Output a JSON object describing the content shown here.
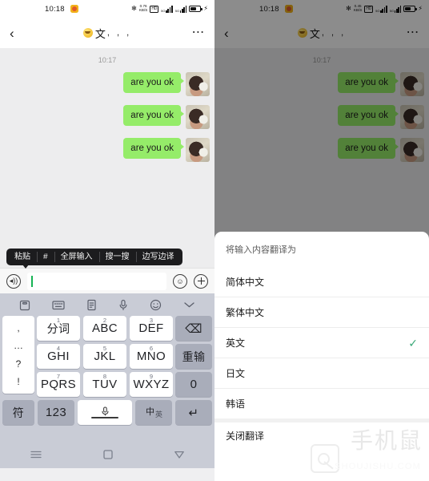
{
  "status_bar": {
    "time": "10:18",
    "app_icon_name": "notification-app-icon",
    "bluetooth_icon": "bluetooth-icon",
    "network_speed_left": "0.76",
    "network_speed_unit_left": "KB/S",
    "network_speed_right": "0.45",
    "network_speed_unit_right": "KB/S",
    "hd_label": "HD",
    "signal_1_label": "5G",
    "signal_2_label": "5G",
    "battery_icon": "battery-icon",
    "charging_icon": "charging-bolt-icon"
  },
  "title_bar": {
    "back_icon": "back-chevron-icon",
    "emoji_icon": "grimacing-face-emoji",
    "contact_name": "文",
    "name_suffix": ", , ,",
    "more_icon": "more-options-icon"
  },
  "chat": {
    "timestamp": "10:17",
    "messages": [
      {
        "text": "are you ok",
        "side": "outgoing"
      },
      {
        "text": "are you ok",
        "side": "outgoing"
      },
      {
        "text": "are you ok",
        "side": "outgoing"
      }
    ],
    "bubble_color": "#95ec69"
  },
  "ime_toolbar": {
    "chips": [
      {
        "label": "粘贴"
      },
      {
        "label": "#"
      },
      {
        "label": "全屏输入"
      },
      {
        "label": "搜一搜"
      },
      {
        "label": "边写边译"
      }
    ]
  },
  "input_bar": {
    "voice_icon": "voice-input-icon",
    "input_value": "",
    "input_placeholder": "",
    "emoji_icon": "emoji-smile-icon",
    "plus_icon": "plus-more-icon",
    "cursor_color": "#16b354"
  },
  "keyboard": {
    "toolbar_icons": [
      "clipboard-icon",
      "keyboard-layout-icon",
      "notes-icon",
      "microphone-icon",
      "emoji-icon",
      "chevron-down-icon"
    ],
    "punct_key": {
      "name": "punctuation-key",
      "glyphs": [
        ",",
        "…",
        "?",
        "!"
      ]
    },
    "keys": [
      {
        "num": "1",
        "label": "分词",
        "cn": true
      },
      {
        "num": "2",
        "label": "ABC",
        "cn": false
      },
      {
        "num": "3",
        "label": "DEF",
        "cn": false
      },
      {
        "num": "4",
        "label": "GHI",
        "cn": false
      },
      {
        "num": "5",
        "label": "JKL",
        "cn": false
      },
      {
        "num": "6",
        "label": "MNO",
        "cn": false
      },
      {
        "num": "7",
        "label": "PQRS",
        "cn": false
      },
      {
        "num": "8",
        "label": "TUV",
        "cn": false
      },
      {
        "num": "9",
        "label": "WXYZ",
        "cn": false
      }
    ],
    "right_keys": [
      {
        "name": "backspace-key",
        "label": "⌫",
        "icon": true
      },
      {
        "name": "redo-key",
        "label": "重输",
        "icon": false
      },
      {
        "name": "zero-key",
        "label": "0",
        "icon": false
      }
    ],
    "bottom_row": {
      "symbol_key": "符",
      "numeric_key": "123",
      "space_key_icon": "microphone-space-icon",
      "lang_key_main": "中",
      "lang_key_sub": "英",
      "enter_key": "↵"
    }
  },
  "nav_bar": {
    "recents_icon": "recents-menu-icon",
    "home_icon": "home-square-icon",
    "back_icon": "back-triangle-icon"
  },
  "translate_sheet": {
    "header": "将输入内容翻译为",
    "options": [
      {
        "label": "简体中文",
        "selected": false
      },
      {
        "label": "繁体中文",
        "selected": false
      },
      {
        "label": "英文",
        "selected": true
      },
      {
        "label": "日文",
        "selected": false
      },
      {
        "label": "韩语",
        "selected": false
      }
    ],
    "close_option": "关闭翻译",
    "check_mark": "✓",
    "check_color": "#3aa877"
  },
  "watermark": {
    "cn_text": "手机鼠",
    "en_text": "SHOUJISHU.COM"
  }
}
